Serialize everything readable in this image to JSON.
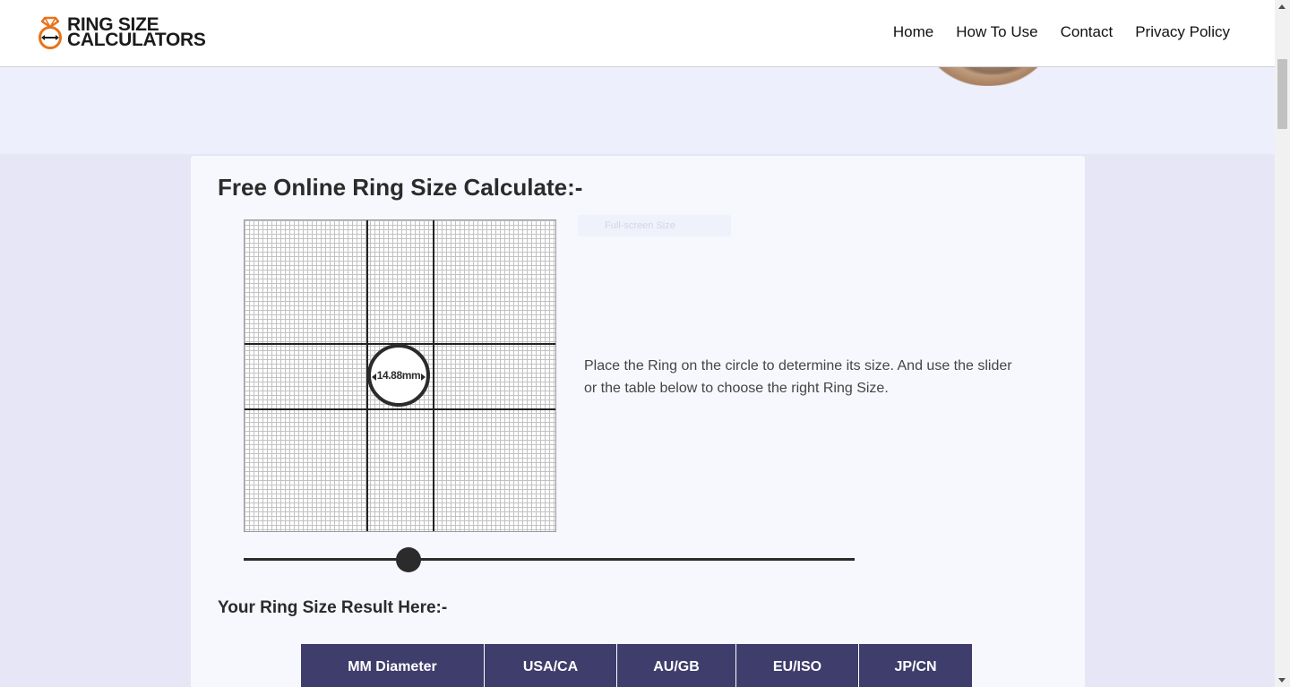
{
  "header": {
    "logo": {
      "line1": "RING SIZE",
      "line2": "CALCULATORS",
      "icon": "ring-measure-icon"
    },
    "nav": [
      {
        "label": "Home"
      },
      {
        "label": "How To Use"
      },
      {
        "label": "Contact"
      },
      {
        "label": "Privacy Policy"
      }
    ]
  },
  "calculator": {
    "title": "Free Online Ring Size Calculate:-",
    "fullscreen_label": "Full-screen Size",
    "ring_diameter_label": "14.88mm",
    "instructions": "Place the Ring on the circle to determine its size. And use the slider or the table below to choose the right Ring Size.",
    "slider_position": 0.26
  },
  "result": {
    "title": "Your Ring Size Result Here:-",
    "table_headers": [
      "MM Diameter",
      "USA/CA",
      "AU/GB",
      "EU/ISO",
      "JP/CN"
    ]
  },
  "colors": {
    "page_background": "#e6e6f7",
    "hero_background": "#edf0fc",
    "table_header": "#3f3d6b",
    "logo_accent": "#e8731a",
    "text_dark": "#2b2b2b"
  }
}
